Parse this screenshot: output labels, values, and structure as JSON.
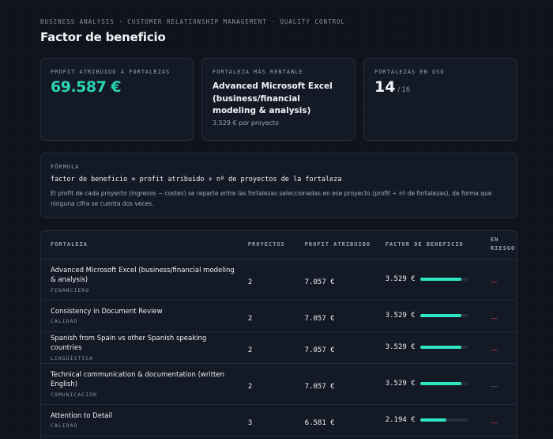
{
  "header": {
    "breadcrumb": "BUSINESS ANALYSIS · CUSTOMER RELATIONSHIP MANAGEMENT · QUALITY CONTROL",
    "title": "Factor de beneficio"
  },
  "cards": {
    "profit": {
      "label": "PROFIT ATRIBUIDO A FORTALEZAS",
      "value": "69.587 €"
    },
    "top_strength": {
      "label": "FORTALEZA MÁS RENTABLE",
      "name": "Advanced Microsoft Excel (business/financial modeling & analysis)",
      "sub": "3.529 € por proyecto"
    },
    "in_use": {
      "label": "FORTALEZAS EN USO",
      "count": "14",
      "separator": "/",
      "total": "16"
    }
  },
  "formula": {
    "label": "FÓRMULA",
    "code": "factor de beneficio = profit atribuido ÷ nº de proyectos de la fortaleza",
    "description": "El profit de cada proyecto (ingresos − costes) se reparte entre las fortalezas seleccionadas en ese proyecto (profit ÷ nº de fortalezas), de forma que ninguna cifra se cuenta dos veces."
  },
  "table": {
    "columns": [
      "FORTALEZA",
      "PROYECTOS",
      "PROFIT ATRIBUIDO",
      "FACTOR DE BENEFICIO",
      "EN RIESGO"
    ],
    "rows": [
      {
        "name": "Advanced Microsoft Excel (business/financial modeling & analysis)",
        "category": "FINANCIERO",
        "projects": "2",
        "profit": "7.057 €",
        "factor": "3.529 €",
        "bar": 0.88,
        "risk": "—",
        "risk_color": "red"
      },
      {
        "name": "Consistency in Document Review",
        "category": "CALIDAD",
        "projects": "2",
        "profit": "7.057 €",
        "factor": "3.529 €",
        "bar": 0.88,
        "risk": "—",
        "risk_color": "red"
      },
      {
        "name": "Spanish from Spain vs other Spanish speaking countries",
        "category": "LINGÜÍSTICA",
        "projects": "2",
        "profit": "7.057 €",
        "factor": "3.529 €",
        "bar": 0.88,
        "risk": "—",
        "risk_color": "red"
      },
      {
        "name": "Technical communication & documentation (written English)",
        "category": "COMUNICACIÓN",
        "projects": "2",
        "profit": "7.057 €",
        "factor": "3.529 €",
        "bar": 0.88,
        "risk": "—",
        "risk_color": "neutral"
      },
      {
        "name": "Attention to Detail",
        "category": "CALIDAD",
        "projects": "3",
        "profit": "6.581 €",
        "factor": "2.194 €",
        "bar": 0.55,
        "risk": "—",
        "risk_color": "red"
      }
    ]
  },
  "colors": {
    "accent": "#2ad4b4",
    "bar": "#2ee6c1",
    "risk": "#e0455a",
    "background": "#0e131c"
  }
}
